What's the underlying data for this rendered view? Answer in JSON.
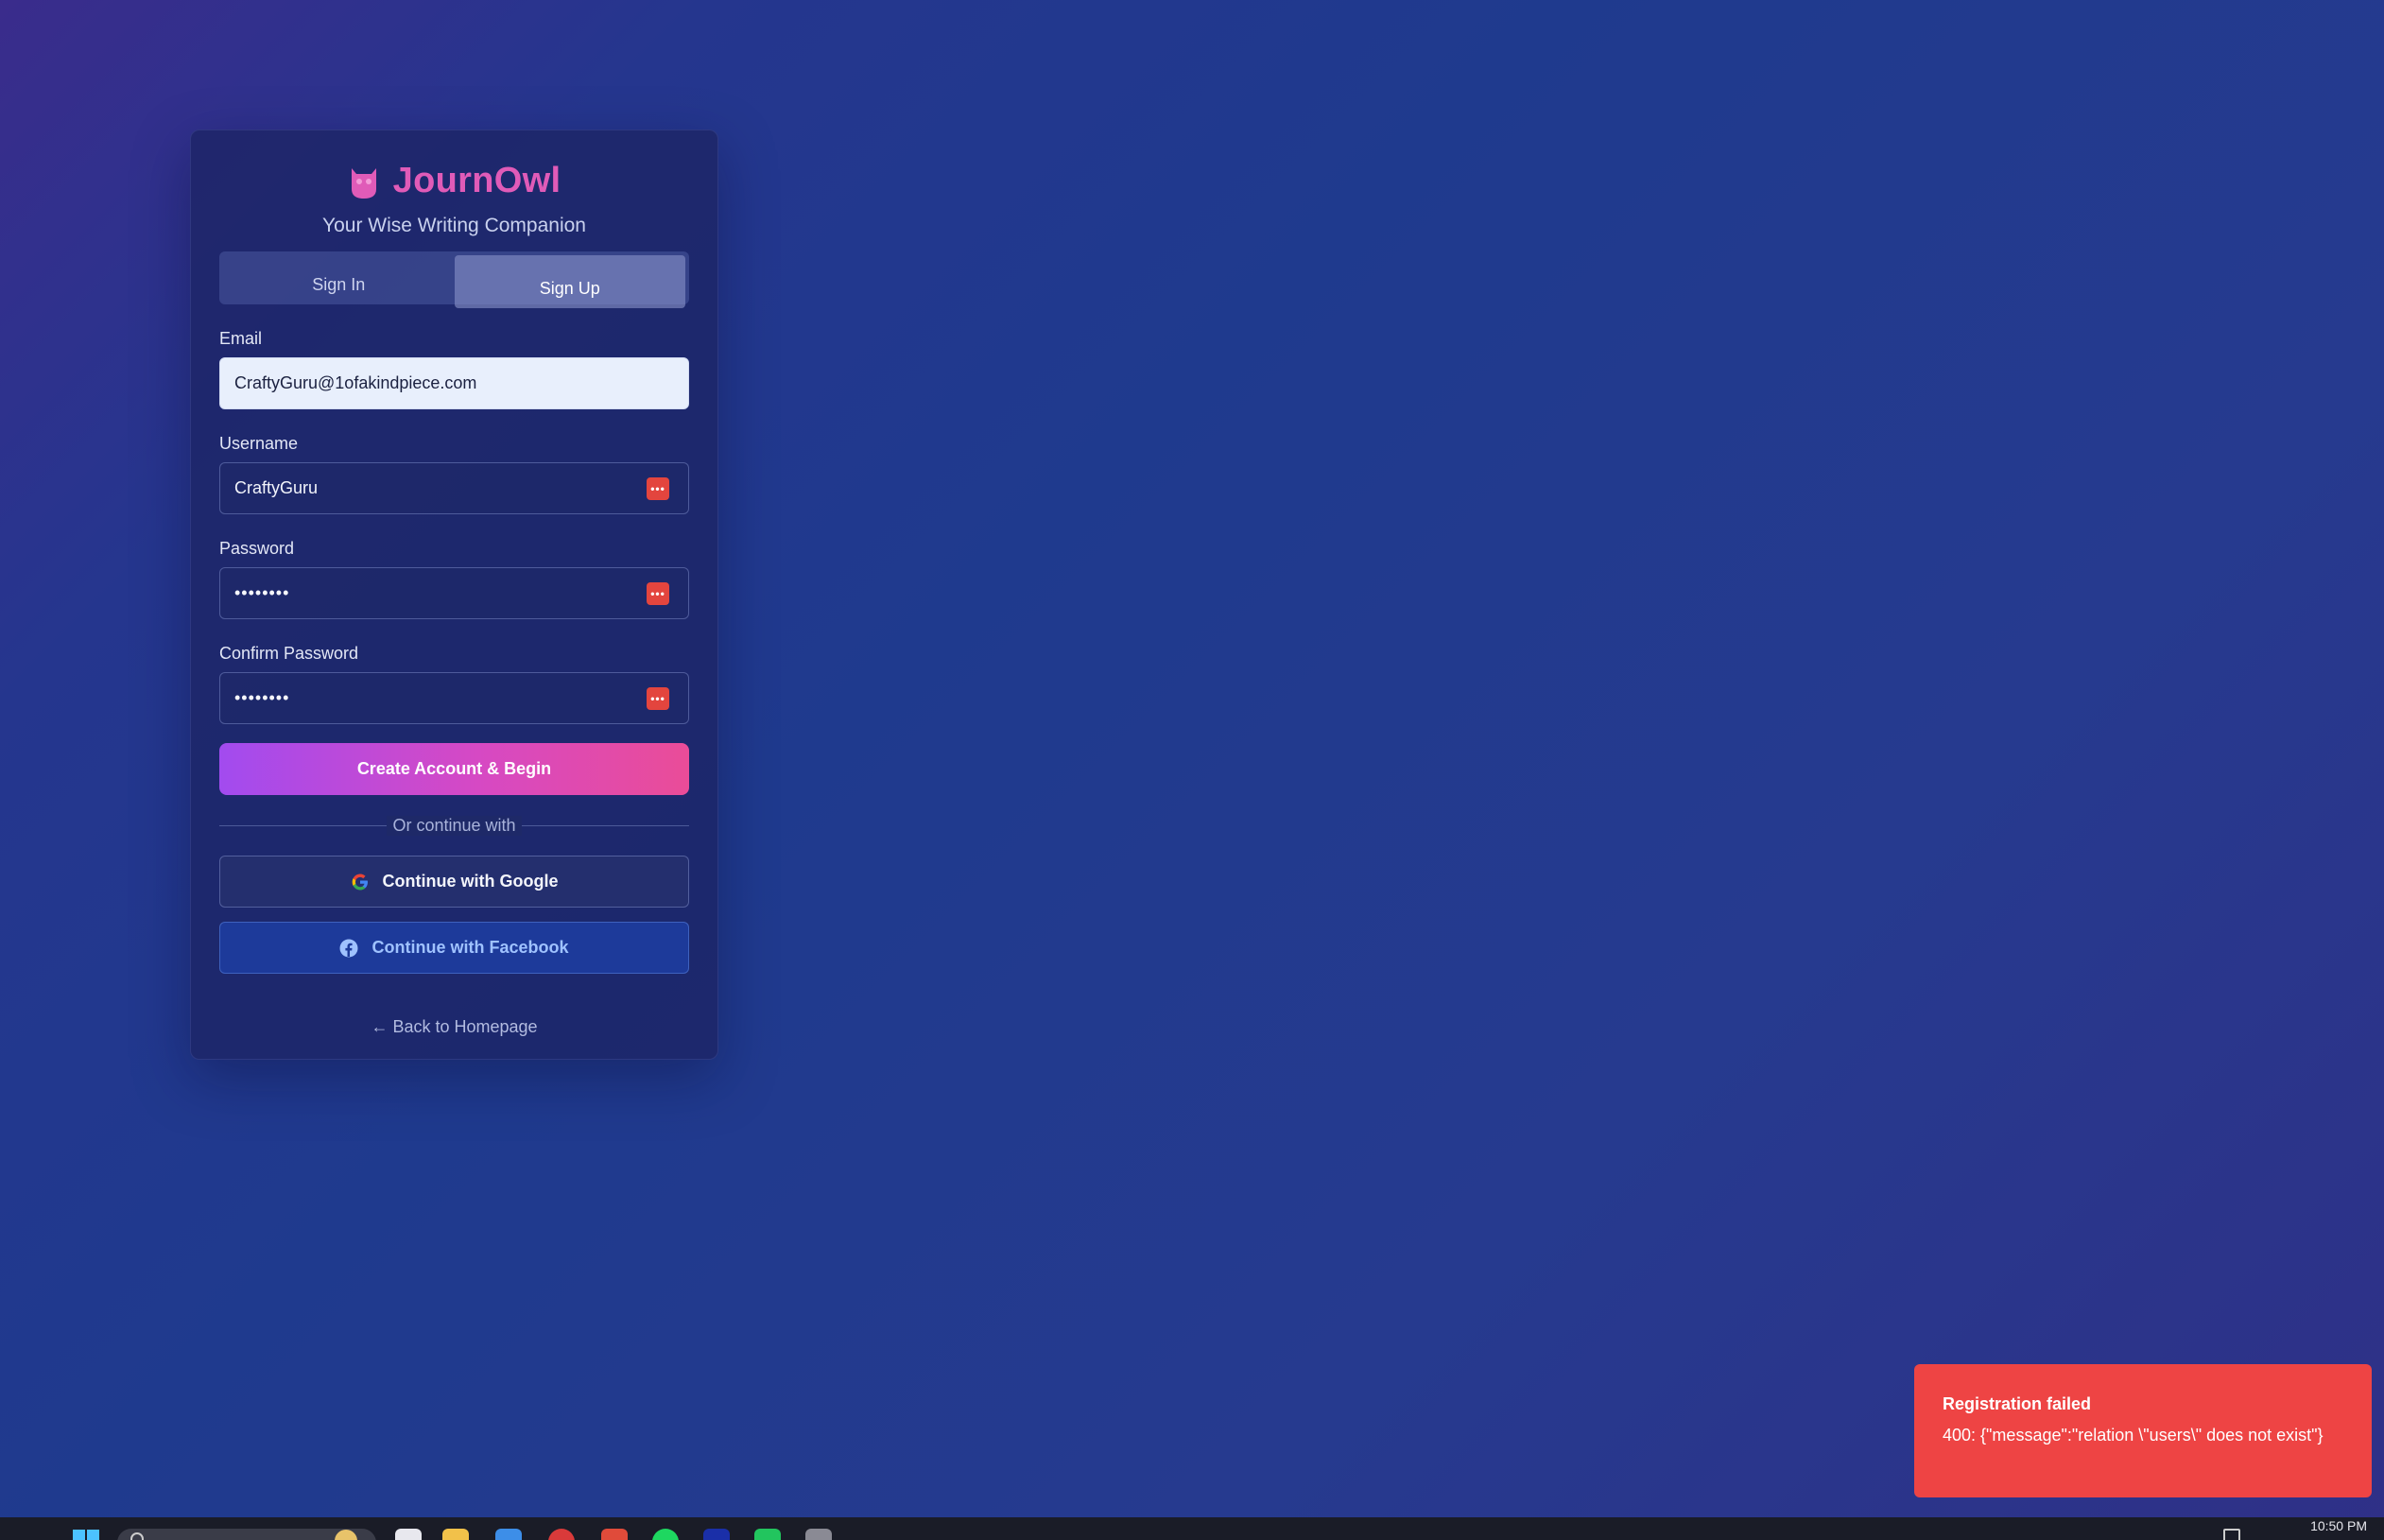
{
  "brand": {
    "name": "JournOwl",
    "tagline": "Your Wise Writing Companion",
    "accent_color": "#e05bb8",
    "logo_icon": "owl-icon"
  },
  "tabs": [
    {
      "label": "Sign In",
      "active": false
    },
    {
      "label": "Sign Up",
      "active": true
    }
  ],
  "form": {
    "email": {
      "label": "Email",
      "value": "CraftyGuru@1ofakindpiece.com"
    },
    "username": {
      "label": "Username",
      "value": "CraftyGuru"
    },
    "password": {
      "label": "Password",
      "value": "••••••••"
    },
    "confirm_password": {
      "label": "Confirm Password",
      "value": "••••••••"
    },
    "submit_label": "Create Account & Begin"
  },
  "divider_text": "Or continue with",
  "oauth": {
    "google_label": "Continue with Google",
    "facebook_label": "Continue with Facebook"
  },
  "back_link": "← Back to Homepage",
  "toast": {
    "title": "Registration failed",
    "message": "400: {\"message\":\"relation \\\"users\\\" does not exist\"}",
    "color": "#ee4444"
  },
  "taskbar": {
    "clock": "10:50 PM"
  }
}
